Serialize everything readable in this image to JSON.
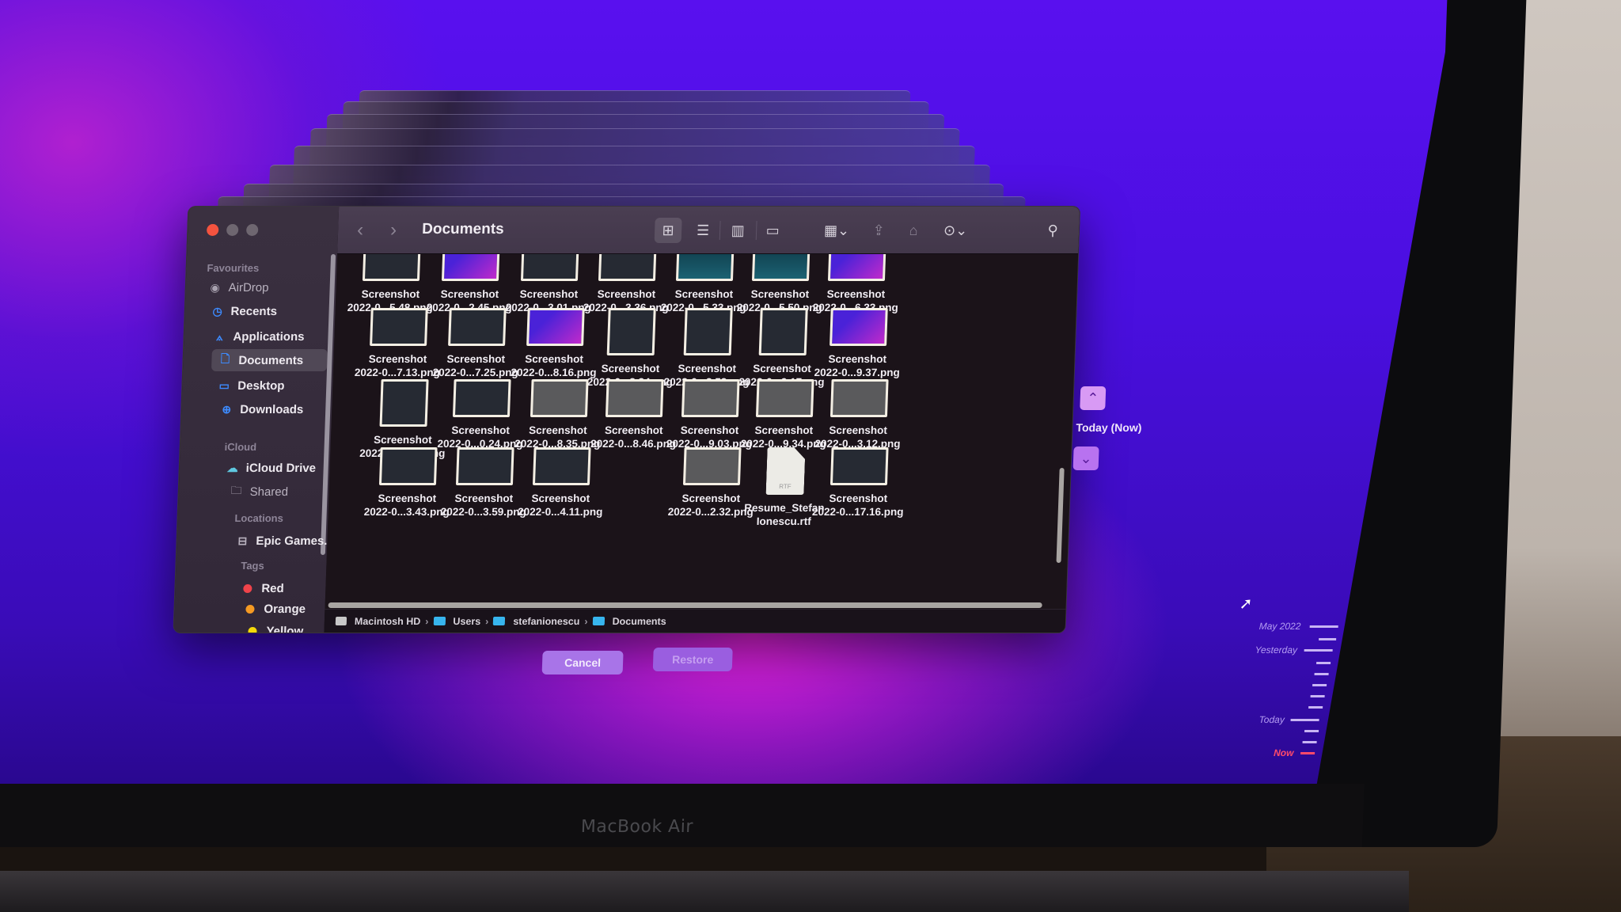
{
  "device": {
    "label": "MacBook Air"
  },
  "finder": {
    "title": "Documents",
    "nav": {
      "back": "‹",
      "forward": "›"
    },
    "toolbar": {
      "icons": [
        "icon-view-icon",
        "list-view-icon",
        "column-view-icon",
        "gallery-view-icon",
        "group-icon",
        "share-icon",
        "tag-icon",
        "more-actions-icon",
        "search-icon"
      ]
    },
    "sidebar": {
      "sections": {
        "favourites": "Favourites",
        "icloud": "iCloud",
        "locations": "Locations",
        "tags": "Tags"
      },
      "favourites": [
        {
          "label": "AirDrop",
          "icon": "airdrop-icon"
        },
        {
          "label": "Recents",
          "icon": "clock-icon"
        },
        {
          "label": "Applications",
          "icon": "applications-icon"
        },
        {
          "label": "Documents",
          "icon": "document-icon",
          "active": true
        },
        {
          "label": "Desktop",
          "icon": "desktop-icon"
        },
        {
          "label": "Downloads",
          "icon": "download-icon"
        }
      ],
      "icloud": [
        {
          "label": "iCloud Drive",
          "icon": "cloud-icon"
        },
        {
          "label": "Shared",
          "icon": "shared-folder-icon"
        }
      ],
      "locations": [
        {
          "label": "Epic Games...",
          "icon": "drive-icon"
        }
      ],
      "tags": [
        {
          "label": "Red",
          "color": "#f0434a"
        },
        {
          "label": "Orange",
          "color": "#f59a23"
        },
        {
          "label": "Yellow",
          "color": "#f5d90a"
        }
      ]
    },
    "files": [
      [
        {
          "line1": "Screenshot",
          "line2": "2022-0...5.48.png"
        },
        {
          "line1": "Screenshot",
          "line2": "2022-0...2.45.png"
        },
        {
          "line1": "Screenshot",
          "line2": "2022-0...3.01.png"
        },
        {
          "line1": "Screenshot",
          "line2": "2022-0...3.36.png"
        },
        {
          "line1": "Screenshot",
          "line2": "2022-0...5.33.png"
        },
        {
          "line1": "Screenshot",
          "line2": "2022-0...5.50.png"
        },
        {
          "line1": "Screenshot",
          "line2": "2022-0...6.33.png"
        }
      ],
      [
        {
          "line1": "Screenshot",
          "line2": "2022-0...7.13.png"
        },
        {
          "line1": "Screenshot",
          "line2": "2022-0...7.25.png"
        },
        {
          "line1": "Screenshot",
          "line2": "2022-0...8.16.png"
        },
        {
          "line1": "Screenshot",
          "line2": "2022-0...8.34.png"
        },
        {
          "line1": "Screenshot",
          "line2": "2022-0...8.53.png"
        },
        {
          "line1": "Screenshot",
          "line2": "2022-0...9.17.png"
        },
        {
          "line1": "Screenshot",
          "line2": "2022-0...9.37.png"
        }
      ],
      [
        {
          "line1": "Screenshot",
          "line2": "2022-0...9.55.png"
        },
        {
          "line1": "Screenshot",
          "line2": "2022-0...0.24.png"
        },
        {
          "line1": "Screenshot",
          "line2": "2022-0...8.35.png"
        },
        {
          "line1": "Screenshot",
          "line2": "2022-0...8.46.png"
        },
        {
          "line1": "Screenshot",
          "line2": "2022-0...9.03.png"
        },
        {
          "line1": "Screenshot",
          "line2": "2022-0...9.34.png"
        },
        {
          "line1": "Screenshot",
          "line2": "2022-0...3.12.png"
        }
      ],
      [
        {
          "line1": "Screenshot",
          "line2": "2022-0...3.43.png"
        },
        {
          "line1": "Screenshot",
          "line2": "2022-0...3.59.png"
        },
        {
          "line1": "Screenshot",
          "line2": "2022-0...4.11.png"
        },
        null,
        {
          "line1": "Screenshot",
          "line2": "2022-0...2.32.png"
        },
        {
          "line1": "Resume_Stefan",
          "line2": "Ionescu.rtf",
          "type": "RTF"
        },
        {
          "line1": "Screenshot",
          "line2": "2022-0...17.16.png"
        }
      ]
    ],
    "path": [
      "Macintosh HD",
      "Users",
      "stefanionescu",
      "Documents"
    ],
    "path_separator": "›"
  },
  "time_machine": {
    "cancel_label": "Cancel",
    "restore_label": "Restore",
    "current_label": "Today (Now)",
    "up_arrow": "⌃",
    "down_arrow": "⌄",
    "timeline": [
      "May 2022",
      "Yesterday",
      "Today",
      "Now"
    ]
  }
}
